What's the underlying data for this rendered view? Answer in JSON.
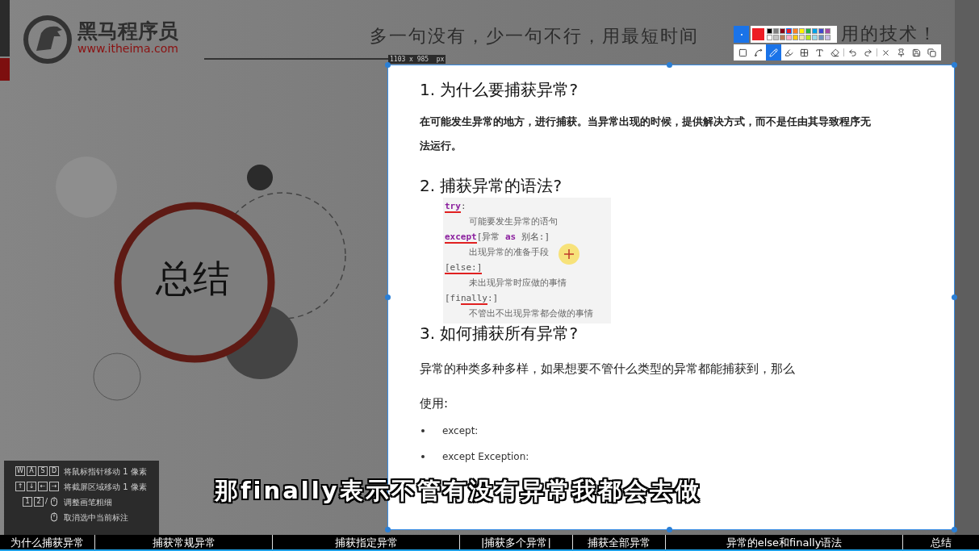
{
  "logo": {
    "name": "黑马程序员",
    "url": "www.itheima.com"
  },
  "slogan": [
    "多一句没有，少一句不行，用最短时间",
    "用的技术！"
  ],
  "slide": {
    "title": "总结"
  },
  "capture": {
    "size": "1103 x 985  px",
    "palette": [
      {
        "color": "#000000"
      },
      {
        "color": "#7f7f7f"
      },
      {
        "color": "#880015"
      },
      {
        "color": "#ed1c24",
        "selected": true
      },
      {
        "color": "#ff7f27"
      },
      {
        "color": "#fff200"
      },
      {
        "color": "#22b14c"
      },
      {
        "color": "#00a2e8"
      },
      {
        "color": "#3f48cc"
      },
      {
        "color": "#a349a4"
      },
      {
        "color": "#ffffff"
      },
      {
        "color": "#c3c3c3"
      },
      {
        "color": "#b97a57"
      },
      {
        "color": "#ffaec9"
      },
      {
        "color": "#ffc90e"
      },
      {
        "color": "#efe4b0"
      },
      {
        "color": "#b5e61d"
      },
      {
        "color": "#99d9ea"
      },
      {
        "color": "#7092be"
      },
      {
        "color": "#c8bfe7"
      }
    ],
    "tools": [
      {
        "kind": "rect",
        "selected": false
      },
      {
        "kind": "line",
        "selected": false
      },
      {
        "kind": "pen",
        "selected": true
      },
      {
        "kind": "marker",
        "selected": false
      },
      {
        "kind": "mosaic",
        "selected": false
      },
      {
        "kind": "text",
        "selected": false
      },
      {
        "kind": "eraser",
        "selected": false
      },
      {
        "kind": "undo",
        "selected": false
      },
      {
        "kind": "redo",
        "selected": false
      },
      {
        "kind": "close",
        "selected": false
      },
      {
        "kind": "pin",
        "selected": false
      },
      {
        "kind": "save",
        "selected": false
      },
      {
        "kind": "copy",
        "selected": false
      }
    ]
  },
  "document": [
    {
      "kind": "heading",
      "text": "1. 为什么要捕获异常?"
    },
    {
      "kind": "paragraph",
      "text": "在可能发生异常的地方，进行捕获。当异常出现的时候，提供解决方式，而不是任由其导致程序无法运行。"
    },
    {
      "kind": "heading",
      "text": "2. 捕获异常的语法?"
    },
    {
      "kind": "code",
      "lines": [
        {
          "indent": false,
          "parts": [
            {
              "text": "try",
              "keyword": true,
              "underlined": true
            },
            {
              "text": ":",
              "keyword": false,
              "underlined": false
            }
          ]
        },
        {
          "indent": true,
          "parts": [
            {
              "text": "可能要发生异常的语句",
              "keyword": false,
              "underlined": false
            }
          ]
        },
        {
          "indent": false,
          "parts": [
            {
              "text": "except",
              "keyword": true,
              "underlined": true
            },
            {
              "text": "[异常 ",
              "keyword": false,
              "underlined": false
            },
            {
              "text": "as",
              "keyword": true,
              "underlined": false
            },
            {
              "text": " 别名:]",
              "keyword": false,
              "underlined": false
            }
          ]
        },
        {
          "indent": true,
          "parts": [
            {
              "text": "出现异常的准备手段",
              "keyword": false,
              "underlined": false
            }
          ]
        },
        {
          "indent": false,
          "parts": [
            {
              "text": "[else:]",
              "keyword": false,
              "underlined": true
            }
          ]
        },
        {
          "indent": true,
          "parts": [
            {
              "text": "未出现异常时应做的事情",
              "keyword": false,
              "underlined": false
            }
          ]
        },
        {
          "indent": false,
          "parts": [
            {
              "text": "[fi",
              "keyword": false,
              "underlined": false
            },
            {
              "text": "nally",
              "keyword": false,
              "underlined": true
            },
            {
              "text": ":]",
              "keyword": false,
              "underlined": false
            }
          ]
        },
        {
          "indent": true,
          "parts": [
            {
              "text": "不管出不出现异常都会做的事情",
              "keyword": false,
              "underlined": false
            }
          ]
        }
      ]
    },
    {
      "kind": "heading",
      "text": "3. 如何捕获所有异常?"
    },
    {
      "kind": "body",
      "text": "异常的种类多种多样，如果想要不管什么类型的异常都能捕获到，那么"
    },
    {
      "kind": "body",
      "text": "使用:"
    },
    {
      "kind": "bullet",
      "text": "except:"
    },
    {
      "kind": "bullet",
      "text": "except Exception:"
    }
  ],
  "subtitle": "那finally表示不管有没有异常我都会去做",
  "shortcuts": [
    {
      "keys": [
        "W",
        "A",
        "S",
        "D"
      ],
      "mouse": false,
      "label": "将鼠标指针移动 1 像素"
    },
    {
      "keys": [
        "↑",
        "↓",
        "←",
        "→"
      ],
      "mouse": false,
      "label": "将截屏区域移动 1 像素"
    },
    {
      "keys": [
        "1",
        "2"
      ],
      "separator": "/",
      "mouse": true,
      "label": "调整画笔粗细"
    },
    {
      "mouse": true,
      "label": "取消选中当前标注"
    }
  ],
  "chapters": [
    {
      "title": "为什么捕获异常"
    },
    {
      "title": "捕获常规异常"
    },
    {
      "title": "捕获指定异常"
    },
    {
      "title": "|捕获多个异常|"
    },
    {
      "title": "捕获全部异常"
    },
    {
      "title": "异常的else和finally语法"
    },
    {
      "title": "总结"
    }
  ]
}
